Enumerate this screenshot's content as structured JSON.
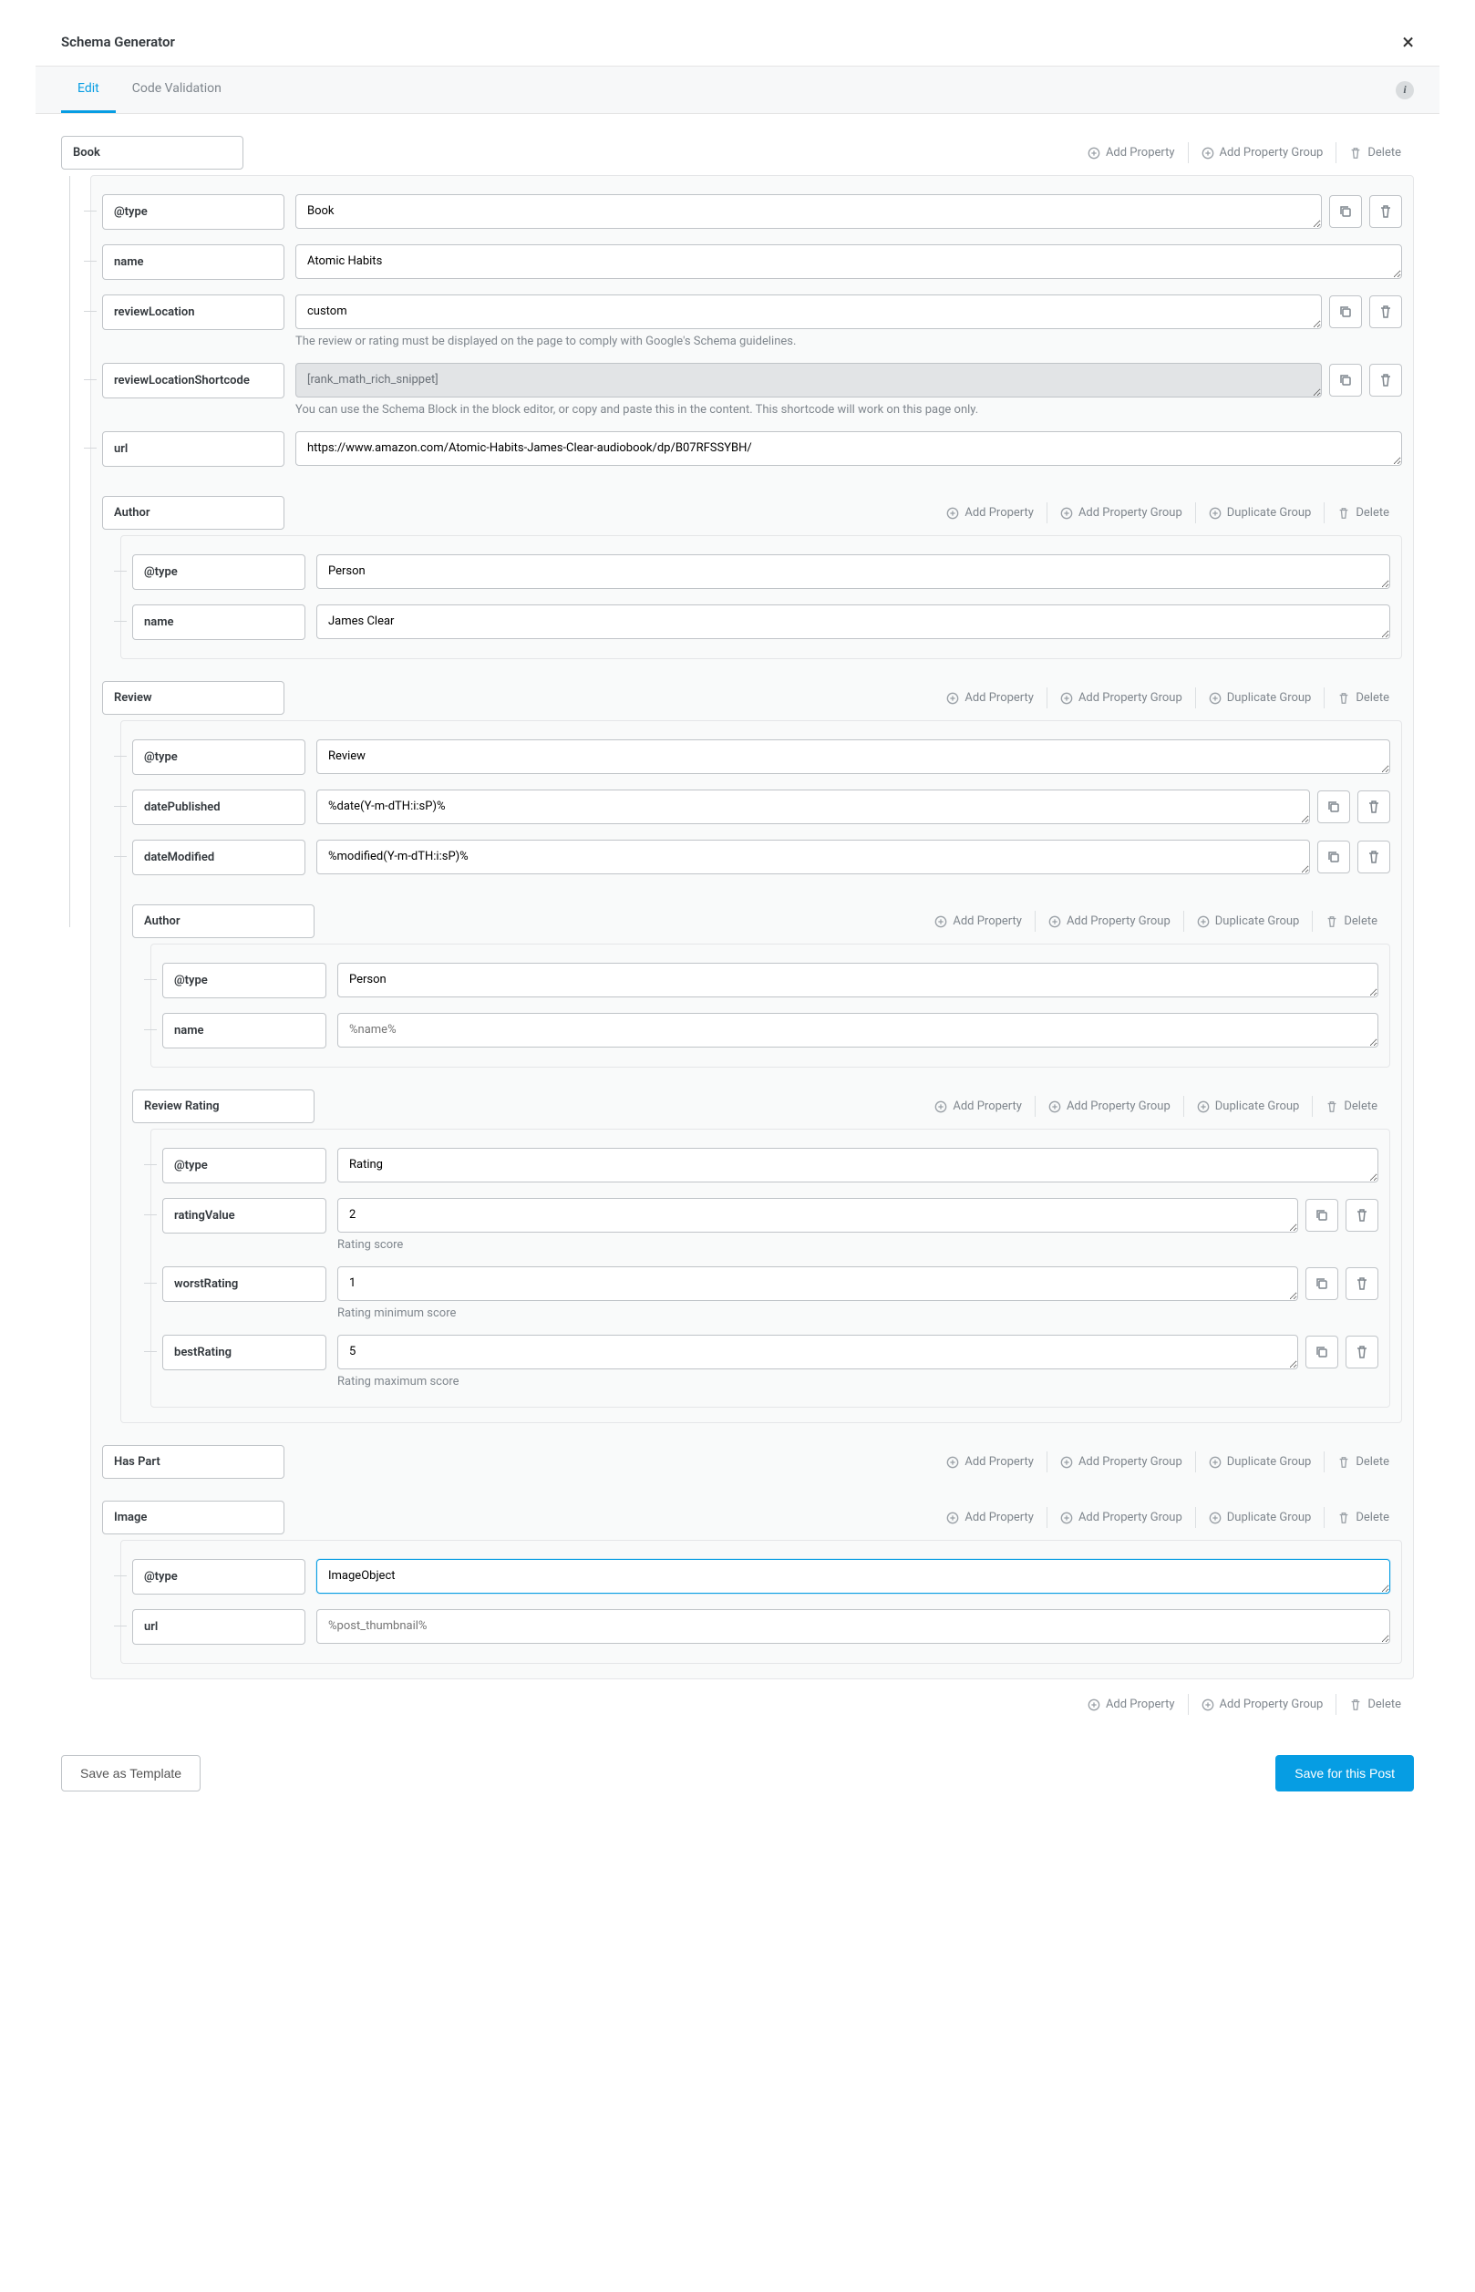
{
  "title": "Schema Generator",
  "tabs": {
    "edit": "Edit",
    "validation": "Code Validation"
  },
  "actions": {
    "addProperty": "Add Property",
    "addPropertyGroup": "Add Property Group",
    "duplicateGroup": "Duplicate Group",
    "delete": "Delete"
  },
  "root": {
    "label": "Book",
    "rows": {
      "type": {
        "label": "@type",
        "value": "Book"
      },
      "name": {
        "label": "name",
        "value": "Atomic Habits"
      },
      "reviewLocation": {
        "label": "reviewLocation",
        "value": "custom",
        "help": "The review or rating must be displayed on the page to comply with Google's Schema guidelines."
      },
      "reviewLocationShortcode": {
        "label": "reviewLocationShortcode",
        "value": "[rank_math_rich_snippet]",
        "help": "You can use the Schema Block in the block editor, or copy and paste this in the content. This shortcode will work on this page only."
      },
      "url": {
        "label": "url",
        "value": "https://www.amazon.com/Atomic-Habits-James-Clear-audiobook/dp/B07RFSSYBH/"
      }
    }
  },
  "author": {
    "label": "Author",
    "type": {
      "label": "@type",
      "value": "Person"
    },
    "name": {
      "label": "name",
      "value": "James Clear"
    }
  },
  "review": {
    "label": "Review",
    "type": {
      "label": "@type",
      "value": "Review"
    },
    "datePublished": {
      "label": "datePublished",
      "value": "%date(Y-m-dTH:i:sP)%"
    },
    "dateModified": {
      "label": "dateModified",
      "value": "%modified(Y-m-dTH:i:sP)%"
    },
    "author": {
      "label": "Author",
      "type": {
        "label": "@type",
        "value": "Person"
      },
      "name": {
        "label": "name",
        "placeholder": "%name%"
      }
    },
    "rating": {
      "label": "Review Rating",
      "type": {
        "label": "@type",
        "value": "Rating"
      },
      "ratingValue": {
        "label": "ratingValue",
        "value": "2",
        "help": "Rating score"
      },
      "worstRating": {
        "label": "worstRating",
        "value": "1",
        "help": "Rating minimum score"
      },
      "bestRating": {
        "label": "bestRating",
        "value": "5",
        "help": "Rating maximum score"
      }
    }
  },
  "hasPart": {
    "label": "Has Part"
  },
  "image": {
    "label": "Image",
    "type": {
      "label": "@type",
      "value": "ImageObject"
    },
    "url": {
      "label": "url",
      "placeholder": "%post_thumbnail%"
    }
  },
  "footer": {
    "saveTemplate": "Save as Template",
    "savePost": "Save for this Post"
  }
}
